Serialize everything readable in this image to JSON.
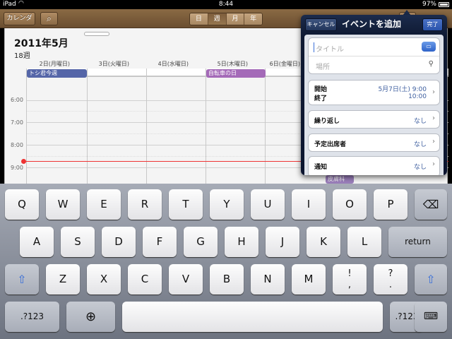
{
  "status": {
    "carrier": "iPad",
    "wifi_icon": "wifi-icon",
    "time": "8:44",
    "battery": "97%"
  },
  "toolbar": {
    "calendars_label": "カレンダー",
    "search_icon": "search-icon",
    "views": [
      "日",
      "週",
      "月",
      "年"
    ],
    "selected_view": "週"
  },
  "calendar": {
    "title": "2011年5月",
    "week": "18週",
    "days": [
      "2日(月曜日)",
      "3日(火曜日)",
      "4日(水曜日)",
      "5日(木曜日)",
      "6日(金曜日)"
    ],
    "times": [
      "6:00",
      "7:00",
      "8:00",
      "9:00"
    ],
    "events": [
      {
        "title": "トシ君今週",
        "color": "#5566a8"
      },
      {
        "title": "自転車の日",
        "color": "#a46ab8"
      },
      {
        "title": "皮膚科",
        "color": "#8b6ab0"
      }
    ]
  },
  "popover": {
    "cancel": "キャンセル",
    "title": "イベントを追加",
    "done": "完了",
    "title_placeholder": "タイトル",
    "location_placeholder": "場所",
    "start_label": "開始",
    "end_label": "終了",
    "start_value": "5月7日(土)  9:00",
    "end_value": "10:00",
    "repeat_label": "繰り返し",
    "repeat_value": "なし",
    "invitees_label": "予定出席者",
    "invitees_value": "なし",
    "alert_label": "通知",
    "alert_value": "なし"
  },
  "keyboard": {
    "row1": [
      "Q",
      "W",
      "E",
      "R",
      "T",
      "Y",
      "U",
      "I",
      "O",
      "P"
    ],
    "row2": [
      "A",
      "S",
      "D",
      "F",
      "G",
      "H",
      "J",
      "K",
      "L"
    ],
    "row3": [
      "Z",
      "X",
      "C",
      "V",
      "B",
      "N",
      "M"
    ],
    "excl": "!\n,",
    "quest": "?\n.",
    "return": "return",
    "numbers": ".?123",
    "shift_icon": "shift-icon",
    "delete_icon": "delete-icon",
    "globe_icon": "globe-icon",
    "hide_icon": "hide-keyboard-icon"
  }
}
